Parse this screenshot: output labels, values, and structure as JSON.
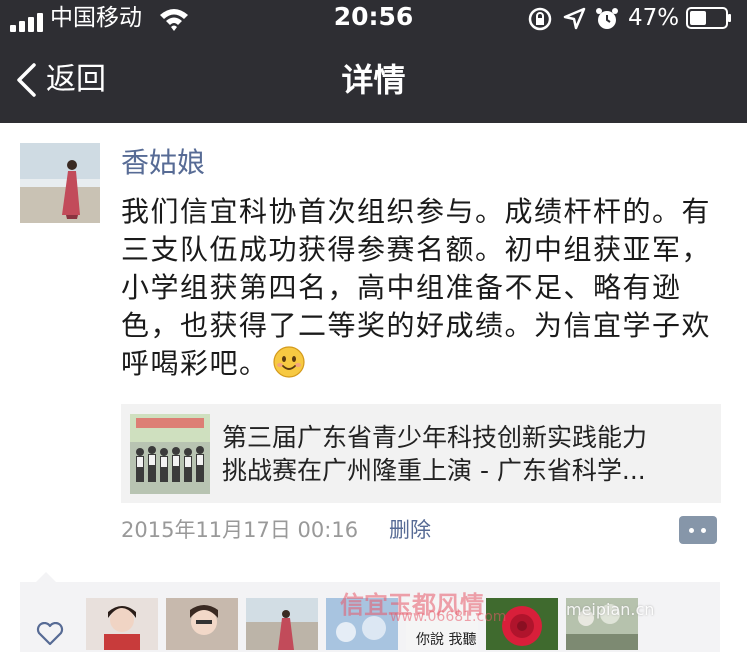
{
  "status_bar": {
    "carrier": "中国移动",
    "time": "20:56",
    "battery_percent": "47%",
    "battery_level": 0.47,
    "icons": [
      "signal-icon",
      "wifi-icon",
      "rotation-lock-icon",
      "location-arrow-icon",
      "alarm-icon",
      "battery-icon"
    ]
  },
  "nav": {
    "back_label": "返回",
    "title": "详情"
  },
  "post": {
    "username": "香姑娘",
    "text": "我们信宜科协首次组织参与。成绩杆杆的。有三支队伍成功获得参赛名额。初中组获亚军，小学组获第四名，高中组准备不足、略有逊色，也获得了二等奖的好成绩。为信宜学子欢呼喝彩吧。",
    "emoji": "smile-emoji",
    "link_card": {
      "line1": "第三届广东省青少年科技创新实践能力",
      "line2": "挑战赛在广州隆重上演 - 广东省科学..."
    },
    "timestamp": "2015年11月17日 00:16",
    "delete_label": "删除"
  },
  "watermarks": {
    "site_name": "信宜玉都风情",
    "site_url": "www.06681.com",
    "slogan": "你說 我聽",
    "platform": "meipian.cn"
  },
  "colors": {
    "nav_background": "#2e2e33",
    "username": "#576b95",
    "timestamp": "#999999",
    "card_background": "#f2f2f2",
    "likes_background": "#f3f3f5"
  }
}
